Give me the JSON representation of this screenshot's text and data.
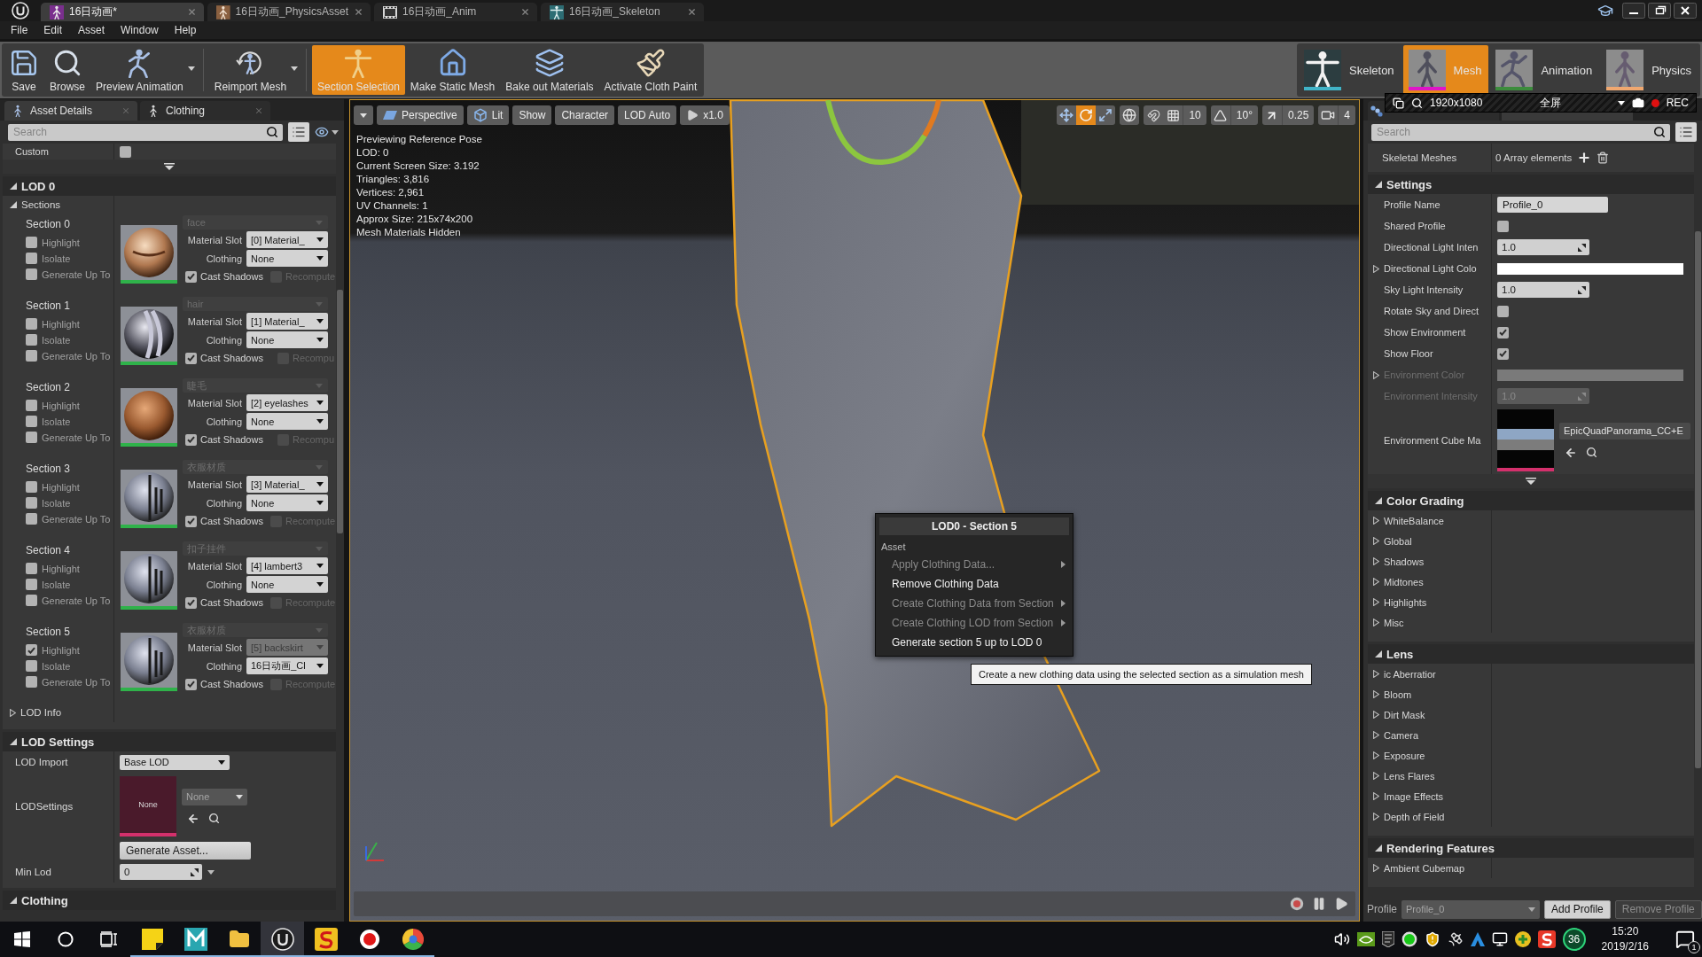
{
  "title_bar": {
    "tabs": [
      {
        "label": "16日动画*",
        "kind": "mesh",
        "selected": true
      },
      {
        "label": "16日动画_PhysicsAsset",
        "kind": "physics",
        "selected": false
      },
      {
        "label": "16日动画_Anim",
        "kind": "anim",
        "selected": false
      },
      {
        "label": "16日动画_Skeleton",
        "kind": "skeleton",
        "selected": false
      }
    ]
  },
  "menu": [
    "File",
    "Edit",
    "Asset",
    "Window",
    "Help"
  ],
  "toolbar": {
    "groups": [
      [
        {
          "label": "Save",
          "kind": "save",
          "dropdown": false,
          "selected": false
        },
        {
          "label": "Browse",
          "kind": "browse",
          "dropdown": false,
          "selected": false
        },
        {
          "label": "Preview Animation",
          "kind": "run",
          "dropdown": true,
          "selected": false
        }
      ],
      [
        {
          "label": "Reimport Mesh",
          "kind": "reimport",
          "dropdown": true,
          "selected": false
        }
      ],
      [
        {
          "label": "Section Selection",
          "kind": "tpose",
          "dropdown": false,
          "selected": true
        },
        {
          "label": "Make Static Mesh",
          "kind": "house",
          "dropdown": false,
          "selected": false
        },
        {
          "label": "Bake out Materials",
          "kind": "layers",
          "dropdown": false,
          "selected": false
        },
        {
          "label": "Activate Cloth Paint",
          "kind": "brush",
          "dropdown": false,
          "selected": false
        }
      ]
    ],
    "modes": [
      {
        "label": "Skeleton",
        "kind": "skeleton",
        "color": "#40b4c8",
        "selected": false
      },
      {
        "label": "Mesh",
        "kind": "mesh",
        "color": "#e014c8",
        "selected": true
      },
      {
        "label": "Animation",
        "kind": "anim",
        "color": "#3c8c3c",
        "selected": false
      },
      {
        "label": "Physics",
        "kind": "physics",
        "color": "#f0a870",
        "selected": false
      }
    ]
  },
  "recorder": {
    "resolution": "1920x1080",
    "mode": "全屏",
    "label": "REC"
  },
  "left_panel": {
    "tabs": [
      {
        "label": "Asset Details",
        "kind": "details",
        "selected": true
      },
      {
        "label": "Clothing",
        "kind": "clothing",
        "selected": false
      }
    ],
    "search": {
      "placeholder": "Search"
    },
    "custom": {
      "label": "Custom",
      "checked": false
    },
    "lod": {
      "title": "LOD 0",
      "expanded": true,
      "sections_label": "Sections",
      "sections_expanded": true,
      "sections": [
        {
          "title": "Section 0",
          "options": [
            {
              "label": "Highlight",
              "checked": false
            },
            {
              "label": "Isolate",
              "checked": false
            },
            {
              "label": "Generate Up To",
              "checked": false
            }
          ],
          "kind": "skin",
          "material": "face",
          "slot_label": "Material Slot",
          "slot": "[0] Material_",
          "slot_disabled": false,
          "clothing_label": "Clothing",
          "clothing": "None",
          "cast_shadows": {
            "label": "Cast Shadows",
            "checked": true
          },
          "recompute": {
            "label": "Recompute",
            "checked": false,
            "disabled": true
          }
        },
        {
          "title": "Section 1",
          "options": [
            {
              "label": "Highlight",
              "checked": false
            },
            {
              "label": "Isolate",
              "checked": false
            },
            {
              "label": "Generate Up To",
              "checked": false
            }
          ],
          "kind": "hair",
          "material": "hair",
          "slot_label": "Material Slot",
          "slot": "[1] Material_",
          "slot_disabled": false,
          "clothing_label": "Clothing",
          "clothing": "None",
          "cast_shadows": {
            "label": "Cast Shadows",
            "checked": true
          },
          "recompute": {
            "label": "Recompu",
            "checked": false,
            "disabled": true
          }
        },
        {
          "title": "Section 2",
          "options": [
            {
              "label": "Highlight",
              "checked": false
            },
            {
              "label": "Isolate",
              "checked": false
            },
            {
              "label": "Generate Up To",
              "checked": false
            }
          ],
          "kind": "lashes",
          "material": "睫毛",
          "slot_label": "Material Slot",
          "slot": "[2] eyelashes",
          "slot_disabled": false,
          "clothing_label": "Clothing",
          "clothing": "None",
          "cast_shadows": {
            "label": "Cast Shadows",
            "checked": true
          },
          "recompute": {
            "label": "Recompu",
            "checked": false,
            "disabled": true
          }
        },
        {
          "title": "Section 3",
          "options": [
            {
              "label": "Highlight",
              "checked": false
            },
            {
              "label": "Isolate",
              "checked": false
            },
            {
              "label": "Generate Up To",
              "checked": false
            }
          ],
          "kind": "cloth",
          "material": "衣服材质",
          "slot_label": "Material Slot",
          "slot": "[3] Material_",
          "slot_disabled": false,
          "clothing_label": "Clothing",
          "clothing": "None",
          "cast_shadows": {
            "label": "Cast Shadows",
            "checked": true
          },
          "recompute": {
            "label": "Recompute",
            "checked": false,
            "disabled": true
          }
        },
        {
          "title": "Section 4",
          "options": [
            {
              "label": "Highlight",
              "checked": false
            },
            {
              "label": "Isolate",
              "checked": false
            },
            {
              "label": "Generate Up To",
              "checked": false
            }
          ],
          "kind": "cloth",
          "material": "扣子挂件",
          "slot_label": "Material Slot",
          "slot": "[4] lambert3",
          "slot_disabled": false,
          "clothing_label": "Clothing",
          "clothing": "None",
          "cast_shadows": {
            "label": "Cast Shadows",
            "checked": true
          },
          "recompute": {
            "label": "Recompute",
            "checked": false,
            "disabled": true
          }
        },
        {
          "title": "Section 5",
          "options": [
            {
              "label": "Highlight",
              "checked": true
            },
            {
              "label": "Isolate",
              "checked": false
            },
            {
              "label": "Generate Up To",
              "checked": false
            }
          ],
          "kind": "cloth",
          "material": "衣服材质",
          "slot_label": "Material Slot",
          "slot": "[5] backskirt",
          "slot_disabled": true,
          "clothing_label": "Clothing",
          "clothing": "16日动画_Cl",
          "cast_shadows": {
            "label": "Cast Shadows",
            "checked": true
          },
          "recompute": {
            "label": "Recompute",
            "checked": false,
            "disabled": true
          }
        }
      ],
      "info": {
        "label": "LOD Info",
        "expanded": false
      }
    },
    "lod_settings": {
      "title": "LOD Settings",
      "expanded": true,
      "import": {
        "label": "LOD Import",
        "value": "Base LOD"
      },
      "settings": {
        "label": "LODSettings",
        "thumbnail": "None",
        "value": "None"
      },
      "generate": "Generate Asset...",
      "min_lod": {
        "label": "Min Lod",
        "value": "0"
      }
    },
    "next_category": {
      "title": "Clothing",
      "expanded": true
    }
  },
  "viewport": {
    "toolbar": [
      {
        "kind": "menu"
      },
      {
        "kind": "perspective",
        "label": "Perspective"
      },
      {
        "kind": "lit",
        "label": "Lit"
      },
      {
        "kind": "plain",
        "label": "Show"
      },
      {
        "kind": "plain",
        "label": "Character"
      },
      {
        "kind": "plain",
        "label": "LOD Auto"
      },
      {
        "kind": "speed",
        "label": "x1.0"
      }
    ],
    "transform": [
      {
        "kind": "move",
        "selected": false
      },
      {
        "kind": "rotate",
        "selected": true
      },
      {
        "kind": "scale",
        "selected": false
      }
    ],
    "snaps": [
      {
        "kind": "world"
      },
      {
        "kind": "grid",
        "value": "10"
      },
      {
        "kind": "angle",
        "value": "10°"
      },
      {
        "kind": "scale",
        "value": "0.25"
      },
      {
        "kind": "camera",
        "value": "4"
      }
    ],
    "info": [
      "Previewing Reference Pose",
      "LOD: 0",
      "Current Screen Size: 3.192",
      "Triangles: 3,816",
      "Vertices: 2,961",
      "UV Channels: 1",
      "Approx Size: 215x74x200",
      "Mesh Materials Hidden"
    ],
    "context_menu": {
      "title": "LOD0 - Section 5",
      "section": "Asset",
      "items": [
        {
          "label": "Apply Clothing Data...",
          "disabled": true,
          "submenu": true
        },
        {
          "label": "Remove Clothing Data",
          "disabled": false,
          "submenu": false
        },
        {
          "label": "Create Clothing Data from Section",
          "disabled": true,
          "submenu": true
        },
        {
          "label": "Create Clothing LOD from Section",
          "disabled": true,
          "submenu": true
        },
        {
          "label": "Generate section 5 up to LOD 0",
          "disabled": false,
          "submenu": false
        }
      ]
    },
    "tooltip": "Create a new clothing data using the selected section as a simulation mesh",
    "playback": [
      {
        "kind": "record"
      },
      {
        "kind": "pause"
      },
      {
        "kind": "play"
      }
    ]
  },
  "right_panel": {
    "tabs": [
      {
        "kind": "morph",
        "selected": false
      },
      {
        "kind": "scene",
        "selected": true
      }
    ],
    "search": {
      "placeholder": "Search"
    },
    "skeletal": {
      "label": "Skeletal Meshes",
      "value": "0 Array elements"
    },
    "categories": [
      {
        "title": "Settings",
        "expanded": true,
        "advanced": true,
        "rows": [
          {
            "kind": "text",
            "label": "Profile Name",
            "value": "Profile_0",
            "disabled": false
          },
          {
            "kind": "check",
            "label": "Shared Profile",
            "checked": false,
            "disabled": false
          },
          {
            "kind": "number",
            "label": "Directional Light Inten",
            "value": "1.0",
            "disabled": false
          },
          {
            "kind": "color",
            "label": "Directional Light Colo",
            "color": "#ffffff",
            "expanded": false,
            "disabled": false
          },
          {
            "kind": "number",
            "label": "Sky Light Intensity",
            "value": "1.0",
            "disabled": false
          },
          {
            "kind": "check",
            "label": "Rotate Sky and Direct",
            "checked": false,
            "disabled": false
          },
          {
            "kind": "check",
            "label": "Show Environment",
            "checked": true,
            "disabled": false
          },
          {
            "kind": "check",
            "label": "Show Floor",
            "checked": true,
            "disabled": false
          },
          {
            "kind": "color",
            "label": "Environment Color",
            "color": "#7a7a7a",
            "expanded": false,
            "disabled": true
          },
          {
            "kind": "number",
            "label": "Environment Intensity",
            "value": "1.0",
            "disabled": true
          },
          {
            "kind": "asset",
            "label": "Environment Cube Ma",
            "value": "EpicQuadPanorama_CC+E",
            "disabled": false
          }
        ]
      },
      {
        "title": "Color Grading",
        "expanded": true,
        "advanced": false,
        "rows": [
          {
            "kind": "group",
            "label": "WhiteBalance",
            "expanded": false
          },
          {
            "kind": "group",
            "label": "Global",
            "expanded": false
          },
          {
            "kind": "group",
            "label": "Shadows",
            "expanded": false
          },
          {
            "kind": "group",
            "label": "Midtones",
            "expanded": false
          },
          {
            "kind": "group",
            "label": "Highlights",
            "expanded": false
          },
          {
            "kind": "group",
            "label": "Misc",
            "expanded": false
          }
        ]
      },
      {
        "title": "Lens",
        "expanded": true,
        "advanced": false,
        "rows": [
          {
            "kind": "group",
            "label": "ic Aberratior",
            "expanded": false
          },
          {
            "kind": "group",
            "label": "Bloom",
            "expanded": false
          },
          {
            "kind": "group",
            "label": "Dirt Mask",
            "expanded": false
          },
          {
            "kind": "group",
            "label": "Camera",
            "expanded": false
          },
          {
            "kind": "group",
            "label": "Exposure",
            "expanded": false
          },
          {
            "kind": "group",
            "label": "Lens Flares",
            "expanded": false
          },
          {
            "kind": "group",
            "label": "Image Effects",
            "expanded": false
          },
          {
            "kind": "group",
            "label": "Depth of Field",
            "expanded": false
          }
        ]
      },
      {
        "title": "Rendering Features",
        "expanded": true,
        "advanced": false,
        "rows": [
          {
            "kind": "group",
            "label": "Ambient Cubemap",
            "expanded": false
          }
        ]
      }
    ],
    "profile_bar": {
      "label": "Profile",
      "dropdown": {
        "value": "Profile_0",
        "disabled": true
      },
      "buttons": [
        {
          "label": "Add Profile",
          "disabled": false
        },
        {
          "label": "Remove Profile",
          "disabled": true
        }
      ]
    }
  },
  "taskbar": {
    "apps": [
      {
        "kind": "start",
        "running": false,
        "selected": false
      },
      {
        "kind": "search",
        "running": false,
        "selected": false
      },
      {
        "kind": "taskview",
        "running": false,
        "selected": false
      },
      {
        "kind": "note",
        "running": true,
        "selected": false
      },
      {
        "kind": "m_tile",
        "running": true,
        "selected": false
      },
      {
        "kind": "folder",
        "running": true,
        "selected": false
      },
      {
        "kind": "u_circle",
        "running": true,
        "selected": true
      },
      {
        "kind": "s_tile",
        "running": true,
        "selected": false
      },
      {
        "kind": "record",
        "running": true,
        "selected": false
      },
      {
        "kind": "wheel",
        "running": true,
        "selected": false
      }
    ],
    "tray": [
      {
        "kind": "speaker"
      },
      {
        "kind": "green_tile"
      },
      {
        "kind": "dark_tile"
      },
      {
        "kind": "green_dot"
      },
      {
        "kind": "shield"
      },
      {
        "kind": "satellite"
      },
      {
        "kind": "a_mark"
      },
      {
        "kind": "monitor"
      },
      {
        "kind": "plus"
      },
      {
        "kind": "s_tile"
      }
    ],
    "counter": "36",
    "time": "15:20",
    "date": "2019/2/16",
    "notifications": "1"
  }
}
